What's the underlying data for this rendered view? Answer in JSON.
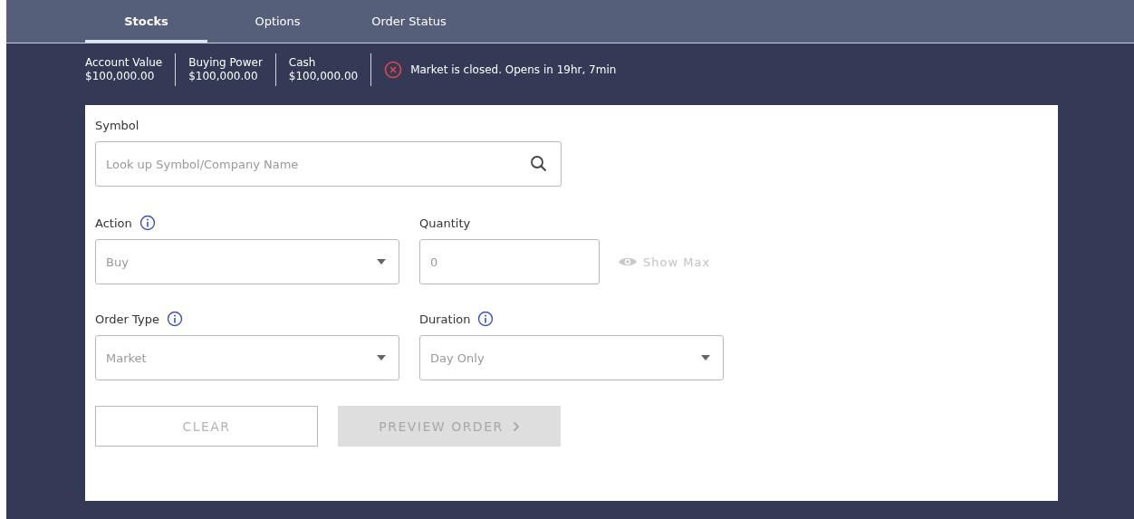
{
  "tabs": [
    {
      "label": "Stocks",
      "selected": true
    },
    {
      "label": "Options",
      "selected": false
    },
    {
      "label": "Order Status",
      "selected": false
    }
  ],
  "account": [
    {
      "label": "Account Value",
      "value": "$100,000.00"
    },
    {
      "label": "Buying Power",
      "value": "$100,000.00"
    },
    {
      "label": "Cash",
      "value": "$100,000.00"
    }
  ],
  "market_status": {
    "text": "Market is closed. Opens in 19hr, 7min",
    "closed": true
  },
  "form_rows": [
    [
      {
        "kind": "search",
        "label": "Symbol",
        "info": false,
        "placeholder": "Look up Symbol/Company Name"
      }
    ],
    [
      {
        "kind": "select",
        "label": "Action",
        "info": true,
        "value": "Buy"
      },
      {
        "kind": "number",
        "label": "Quantity",
        "info": false,
        "placeholder": "0",
        "link": "Show Max"
      }
    ],
    [
      {
        "kind": "select",
        "label": "Order Type",
        "info": true,
        "value": "Market"
      },
      {
        "kind": "select",
        "label": "Duration",
        "info": true,
        "value": "Day Only"
      }
    ]
  ],
  "buttons": [
    {
      "kind": "outline",
      "label": "CLEAR",
      "disabled": true
    },
    {
      "kind": "primary",
      "label": "PREVIEW ORDER",
      "disabled": true
    }
  ]
}
